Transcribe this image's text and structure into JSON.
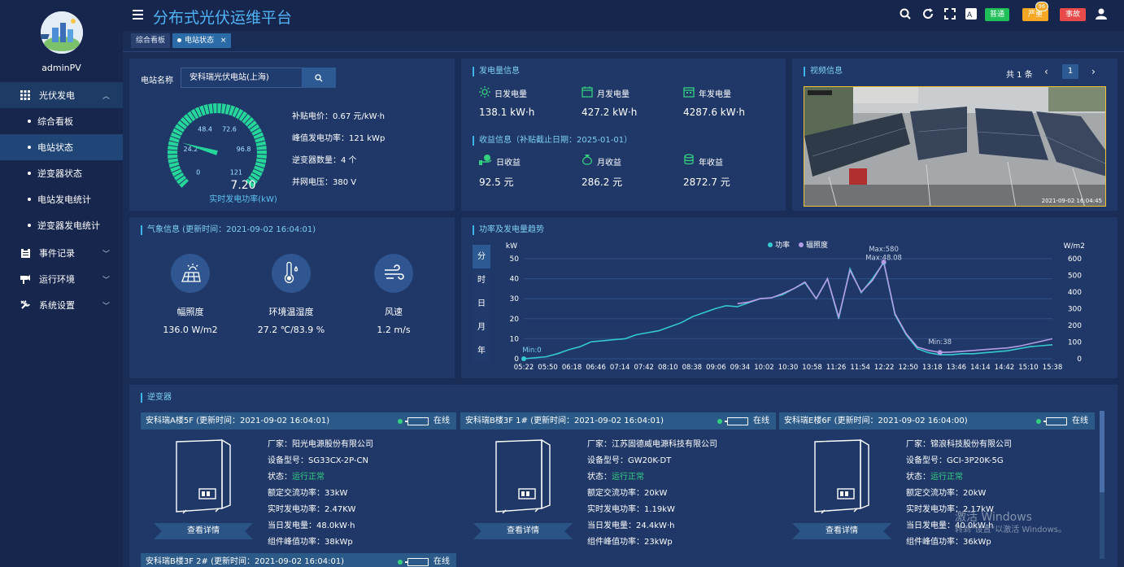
{
  "user": {
    "name": "adminPV"
  },
  "header": {
    "title": "分布式光伏运维平台",
    "badge_normal": "普通",
    "badge_serious": "严重",
    "badge_serious_count": "96",
    "badge_fault": "事故"
  },
  "tabs": [
    {
      "label": "综合看板"
    },
    {
      "label": "电站状态",
      "close": "×"
    }
  ],
  "menu": {
    "pv": "光伏发电",
    "subs": [
      "综合看板",
      "电站状态",
      "逆变器状态",
      "电站发电统计",
      "逆变器发电统计"
    ],
    "events": "事件记录",
    "env": "运行环境",
    "settings": "系统设置"
  },
  "station": {
    "name_label": "电站名称",
    "name_value": "安科瑞光伏电站(上海)",
    "gauge_value": "7.20",
    "gauge_max": 121,
    "gauge_caption": "实时发电功率(kW)",
    "gauge_ticks": [
      "0",
      "24.2",
      "48.4",
      "72.6",
      "96.8",
      "121"
    ],
    "info": [
      "补贴电价：0.67 元/kW·h",
      "峰值发电功率：121 kWp",
      "逆变器数量：4 个",
      "并网电压：380 V"
    ]
  },
  "gen": {
    "title": "发电量信息",
    "day_label": "日发电量",
    "day_value": "138.1 kW·h",
    "month_label": "月发电量",
    "month_value": "427.2 kW·h",
    "year_label": "年发电量",
    "year_value": "4287.6 kW·h",
    "rev_title": "收益信息（补贴截止日期：2025-01-01）",
    "rday_label": "日收益",
    "rday_value": "92.5 元",
    "rmonth_label": "月收益",
    "rmonth_value": "286.2 元",
    "ryear_label": "年收益",
    "ryear_value": "2872.7 元"
  },
  "video": {
    "title": "视频信息",
    "count": "共 1 条",
    "page": "1",
    "timestamp": "2021-09-02 16:04:45"
  },
  "weather": {
    "title": "气象信息 (更新时间：2021-09-02 16:04:01)",
    "irr_label": "幅照度",
    "irr_value": "136.0 W/m2",
    "temp_label": "环境温湿度",
    "temp_value": "27.2 ℃/83.9 %",
    "wind_label": "风速",
    "wind_value": "1.2 m/s"
  },
  "trend": {
    "title": "功率及发电量趋势",
    "periods": [
      "分",
      "时",
      "日",
      "月",
      "年"
    ],
    "legend_power": "功率",
    "legend_irr": "辐照度"
  },
  "chart_data": {
    "type": "line",
    "ylabel_left": "kW",
    "ylabel_right": "W/m2",
    "ylim_left": [
      0,
      50
    ],
    "ylim_right": [
      0,
      600
    ],
    "yticks_left": [
      "0",
      "10",
      "20",
      "30",
      "40",
      "50"
    ],
    "yticks_right": [
      "0",
      "100",
      "200",
      "300",
      "400",
      "500",
      "600"
    ],
    "xticks": [
      "05:22",
      "05:50",
      "06:18",
      "06:46",
      "07:14",
      "07:42",
      "08:10",
      "08:38",
      "09:06",
      "09:34",
      "10:02",
      "10:30",
      "10:58",
      "11:26",
      "11:54",
      "12:22",
      "12:50",
      "13:18",
      "13:46",
      "14:14",
      "14:42",
      "15:10",
      "15:38"
    ],
    "annotations": {
      "max_irr": "Max:580",
      "max_power": "Max:48.08",
      "min_power": "Min:0",
      "min_irr": "Min:38"
    },
    "series": [
      {
        "name": "功率",
        "color": "#35c9d0",
        "axis": "left",
        "values": [
          0,
          0.5,
          1,
          2.5,
          4.5,
          6,
          8.5,
          9,
          9.5,
          10,
          12,
          13,
          14,
          16,
          18,
          21,
          23,
          25,
          26.5,
          26,
          28,
          30,
          30.5,
          32,
          35,
          38,
          30,
          40,
          20,
          45,
          33,
          40,
          48.08,
          22,
          12,
          5,
          3,
          2,
          2,
          2.5,
          2.5,
          3,
          3.5,
          4,
          5,
          6,
          6.5,
          7
        ]
      },
      {
        "name": "辐照度",
        "color": "#b59ce6",
        "axis": "right",
        "values": [
          0,
          0,
          0,
          0,
          0,
          0,
          0,
          0,
          0,
          0,
          0,
          0,
          0,
          0,
          0,
          0,
          0,
          0,
          0,
          330,
          340,
          360,
          365,
          390,
          420,
          460,
          360,
          480,
          250,
          530,
          400,
          470,
          580,
          270,
          150,
          70,
          50,
          38,
          40,
          45,
          50,
          55,
          60,
          65,
          75,
          90,
          105,
          120
        ]
      }
    ]
  },
  "inverter": {
    "title": "逆变器",
    "status_online": "在线",
    "detail_btn": "查看详情",
    "cards": [
      {
        "name": "安科瑞A楼5F (更新时间：2021-09-02 16:04:01)",
        "maker": "厂家：阳光电源股份有限公司",
        "model": "设备型号：SG33CX-2P-CN",
        "state_label": "状态：",
        "state": "运行正常",
        "rated": "额定交流功率：33kW",
        "realtime": "实时发电功率：2.47KW",
        "daily": "当日发电量：48.0kW·h",
        "peak": "组件峰值功率：38kWp"
      },
      {
        "name": "安科瑞B楼3F 1# (更新时间：2021-09-02 16:04:01)",
        "maker": "厂家：江苏固德威电源科技有限公司",
        "model": "设备型号：GW20K-DT",
        "state_label": "状态：",
        "state": "运行正常",
        "rated": "额定交流功率：20kW",
        "realtime": "实时发电功率：1.19kW",
        "daily": "当日发电量：24.4kW·h",
        "peak": "组件峰值功率：23kWp"
      },
      {
        "name": "安科瑞E楼6F (更新时间：2021-09-02 16:04:00)",
        "maker": "厂家：锦浪科技股份有限公司",
        "model": "设备型号：GCI-3P20K-5G",
        "state_label": "状态：",
        "state": "运行正常",
        "rated": "额定交流功率：20kW",
        "realtime": "实时发电功率：2.17kW",
        "daily": "当日发电量：40.0kW·h",
        "peak": "组件峰值功率：36kWp"
      }
    ],
    "next_card_name": "安科瑞B楼3F 2# (更新时间：2021-09-02 16:04:01)"
  },
  "watermark": {
    "line1": "激活 Windows",
    "line2": "转到\"设置\"以激活 Windows。"
  }
}
